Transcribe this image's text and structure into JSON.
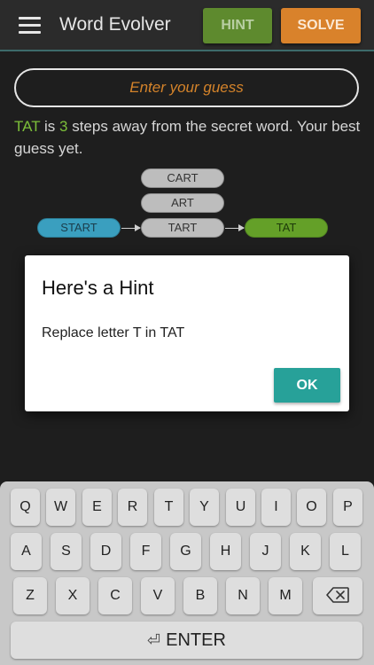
{
  "appbar": {
    "title": "Word Evolver",
    "menu_icon": "hamburger-menu-icon",
    "hint_label": "HINT",
    "solve_label": "SOLVE"
  },
  "guess": {
    "placeholder": "Enter your guess",
    "value": ""
  },
  "feedback": {
    "word": "TAT",
    "text_is": " is ",
    "steps": "3",
    "text_rest": " steps away from the secret word. Your best guess yet."
  },
  "chain": {
    "start": "START",
    "middle": [
      "CART",
      "ART",
      "TART"
    ],
    "end": "TAT"
  },
  "dialog": {
    "title": "Here's a Hint",
    "message": "Replace letter T in TAT",
    "ok_label": "OK"
  },
  "keyboard": {
    "row1": [
      "Q",
      "W",
      "E",
      "R",
      "T",
      "Y",
      "U",
      "I",
      "O",
      "P"
    ],
    "row2": [
      "A",
      "S",
      "D",
      "F",
      "G",
      "H",
      "J",
      "K",
      "L"
    ],
    "row3": [
      "Z",
      "X",
      "C",
      "V",
      "B",
      "N",
      "M"
    ],
    "backspace_icon": "backspace-icon",
    "enter_icon": "enter-return-icon",
    "enter_label": "ENTER"
  },
  "colors": {
    "hint": "#5e8a2e",
    "solve": "#d9822b",
    "accent_green": "#7cbf3a",
    "start_pill": "#3a9fbf",
    "end_pill": "#64a028",
    "ok_button": "#27a199"
  }
}
